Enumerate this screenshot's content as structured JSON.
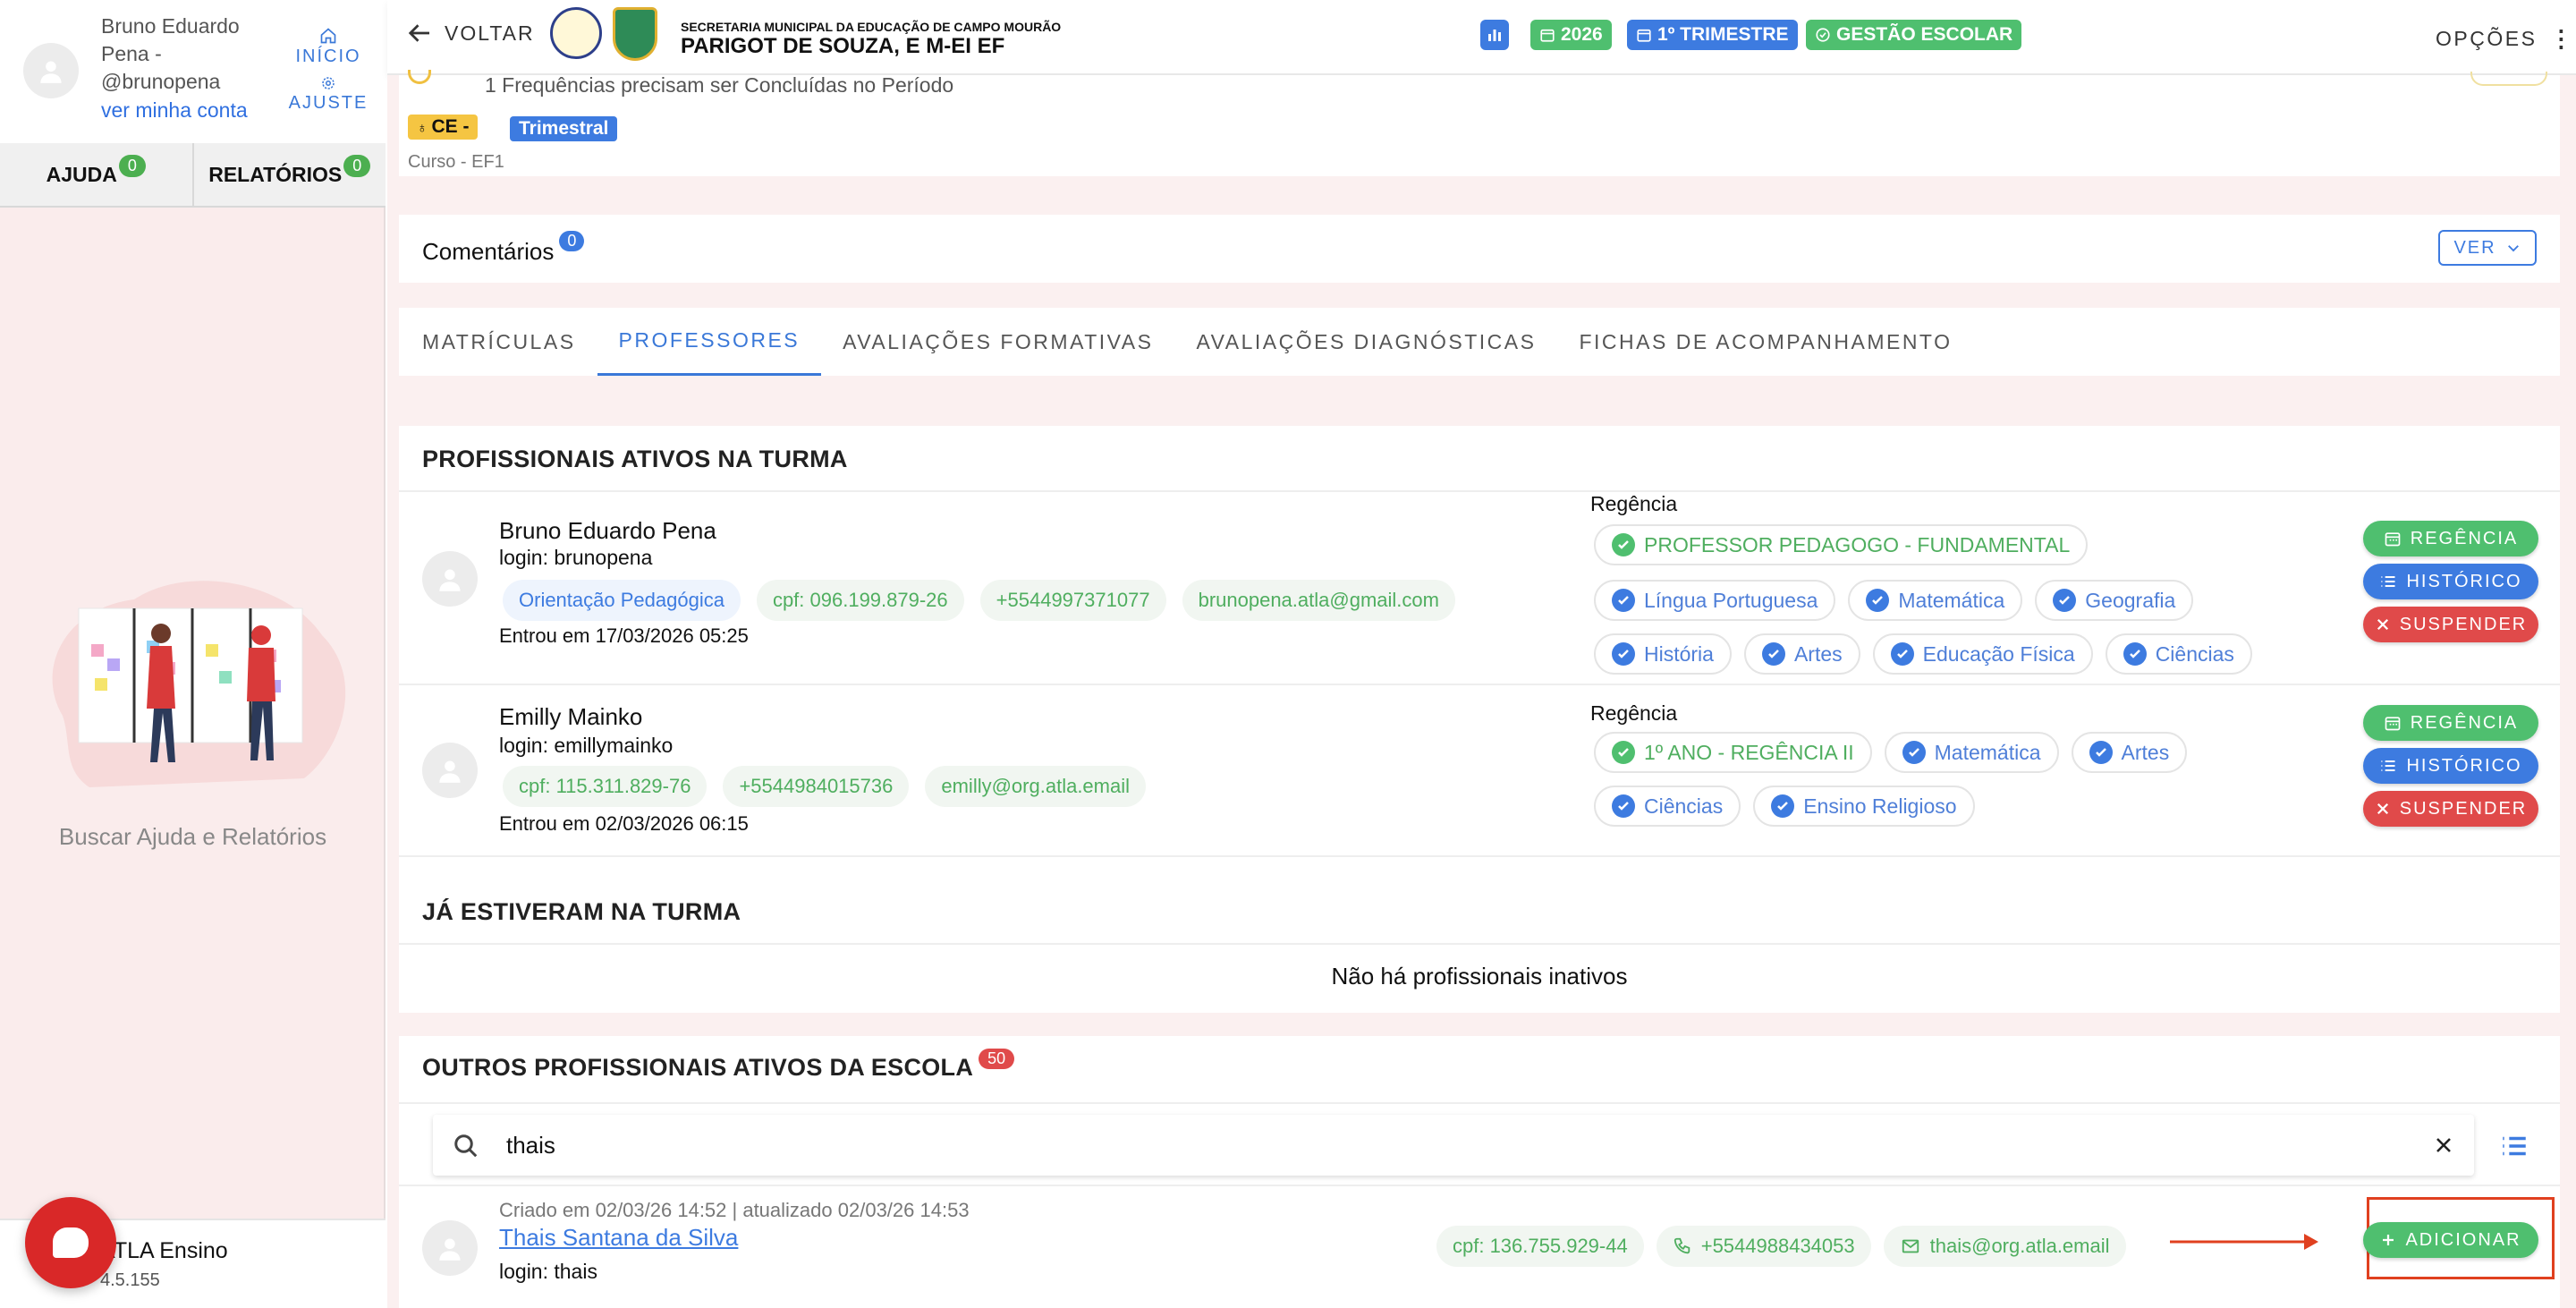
{
  "sidebar": {
    "user_name": "Bruno Eduardo Pena - @brunopena",
    "account_link": "ver minha conta",
    "nav_home": "INÍCIO",
    "nav_settings": "AJUSTE",
    "tabs": [
      {
        "label": "AJUDA",
        "count": "0"
      },
      {
        "label": "RELATÓRIOS",
        "count": "0"
      }
    ],
    "help_caption": "Buscar Ajuda e Relatórios",
    "app_name": "ATLA Ensino",
    "app_version": "4.5.155"
  },
  "topbar": {
    "back_label": "VOLTAR",
    "secretaria": "SECRETARIA MUNICIPAL DA EDUCAÇÃO DE CAMPO MOURÃO",
    "school": "PARIGOT DE SOUZA, E M-EI EF",
    "year": "2026",
    "period": "1º TRIMESTRE",
    "module": "GESTÃO ESCOLAR",
    "options_label": "OPÇÕES",
    "colors": {
      "blue": "#3d7be0",
      "green": "#4fbf6f"
    }
  },
  "class_info": {
    "warning": "1 Frequências precisam ser Concluídas no Período",
    "tag_ce": "CE -",
    "tag_period": "Trimestral",
    "course": "Curso - EF1"
  },
  "comments": {
    "label": "Comentários",
    "count": "0",
    "view_label": "VER"
  },
  "tabs": [
    {
      "label": "MATRÍCULAS",
      "active": false
    },
    {
      "label": "PROFESSORES",
      "active": true
    },
    {
      "label": "AVALIAÇÕES FORMATIVAS",
      "active": false
    },
    {
      "label": "AVALIAÇÕES DIAGNÓSTICAS",
      "active": false
    },
    {
      "label": "FICHAS DE ACOMPANHAMENTO",
      "active": false
    }
  ],
  "active_section": {
    "title": "PROFISSIONAIS ATIVOS NA TURMA",
    "regencia_label": "Regência",
    "professionals": [
      {
        "name": "Bruno Eduardo Pena",
        "login": "login: brunopena",
        "role_chip": "Orientação Pedagógica",
        "cpf": "cpf: 096.199.879-26",
        "phone": "+5544997371077",
        "email": "brunopena.atla@gmail.com",
        "joined": "Entrou em 17/03/2026 05:25",
        "regencia": [
          [
            "PROFESSOR PEDAGOGO - FUNDAMENTAL"
          ],
          [
            "Língua Portuguesa",
            "Matemática",
            "Geografia"
          ],
          [
            "História",
            "Artes",
            "Educação Física",
            "Ciências"
          ]
        ]
      },
      {
        "name": "Emilly Mainko",
        "login": "login: emillymainko",
        "cpf": "cpf: 115.311.829-76",
        "phone": "+5544984015736",
        "email": "emilly@org.atla.email",
        "joined": "Entrou em 02/03/2026 06:15",
        "regencia": [
          [
            "1º ANO - REGÊNCIA II",
            "Matemática",
            "Artes"
          ],
          [
            "Ciências",
            "Ensino Religioso"
          ]
        ]
      }
    ],
    "buttons": {
      "regencia": "REGÊNCIA",
      "historico": "HISTÓRICO",
      "suspender": "SUSPENDER"
    }
  },
  "inactive_section": {
    "title": "JÁ ESTIVERAM NA TURMA",
    "empty_message": "Não há profissionais inativos"
  },
  "others_section": {
    "title": "OUTROS PROFISSIONAIS ATIVOS DA ESCOLA",
    "count": "50",
    "search_value": "thais",
    "result": {
      "meta": "Criado em 02/03/26 14:52 | atualizado 02/03/26 14:53",
      "name": "Thais Santana da Silva",
      "login": "login: thais",
      "cpf": "cpf: 136.755.929-44",
      "phone": "+5544988434053",
      "email": "thais@org.atla.email",
      "add_label": "ADICIONAR"
    }
  },
  "icons": [
    "arrow-left-icon",
    "home-icon",
    "gear-icon",
    "chart-icon",
    "calendar-icon",
    "check-circle-icon",
    "chevron-down-icon",
    "search-icon",
    "close-icon",
    "list-icon",
    "plus-icon",
    "phone-icon",
    "mail-icon",
    "user-avatar-icon"
  ]
}
